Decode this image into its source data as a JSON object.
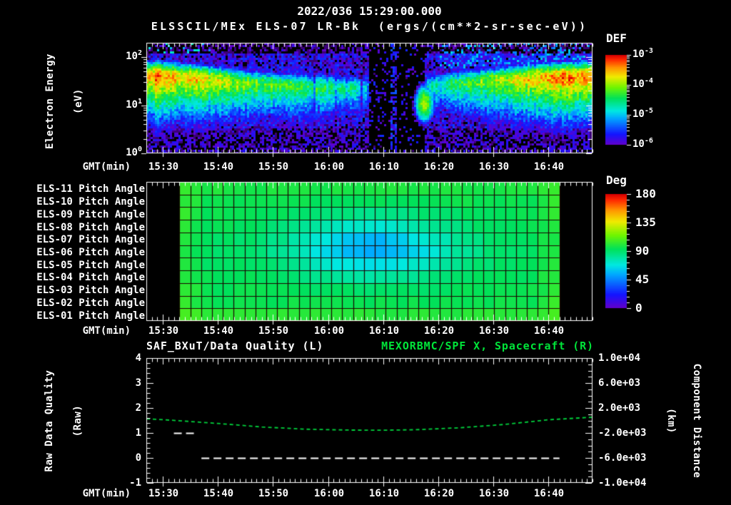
{
  "header": {
    "title": "2022/036 15:29:00.000",
    "subtitle": "ELSSCIL/MEx ELS-07 LR-Bk  (ergs/(cm**2-sr-sec-eV))"
  },
  "axis_x": {
    "label": "GMT(min)",
    "ticks": [
      "15:30",
      "15:40",
      "15:50",
      "16:00",
      "16:10",
      "16:20",
      "16:30",
      "16:40"
    ],
    "range": [
      "15:27",
      "16:48"
    ],
    "minor_step_min": 1,
    "major_step_min": 10
  },
  "colors": {
    "background": "#000000",
    "text": "#ffffff",
    "accent_green": "#00e439",
    "curve_green": "#00d23c",
    "grid_dark": "#1c0600"
  },
  "chart_data": [
    {
      "type": "heatmap",
      "name": "energy-spectrogram",
      "ylabel": {
        "line1": "Electron Energy",
        "line2": "(eV)"
      },
      "y_scale": "log",
      "y_ticks": [
        {
          "exp": "2"
        },
        {
          "exp": "1"
        },
        {
          "exp": "0"
        }
      ],
      "y_range_eV": [
        1,
        186
      ],
      "colorbar": {
        "title": "DEF",
        "units": "ergs/(cm**2-sr-sec-eV)",
        "ticks": [
          {
            "exp": "-3"
          },
          {
            "exp": "-4"
          },
          {
            "exp": "-5"
          },
          {
            "exp": "-6"
          }
        ],
        "range_log10": [
          -6,
          -3
        ]
      },
      "features": {
        "band_keypoints": [
          {
            "t": 0,
            "amp": -3.5,
            "center_logE": 1.6
          },
          {
            "t": 6,
            "amp": -3.6,
            "center_logE": 1.57
          },
          {
            "t": 13,
            "amp": -3.85,
            "center_logE": 1.5
          },
          {
            "t": 20,
            "amp": -4.15,
            "center_logE": 1.43
          },
          {
            "t": 28,
            "amp": -4.35,
            "center_logE": 1.38
          },
          {
            "t": 36,
            "amp": -4.5,
            "center_logE": 1.36
          },
          {
            "t": 40,
            "amp": -5.0,
            "center_logE": 1.35
          },
          {
            "t": 41,
            "amp": -6.6,
            "center_logE": 1.32
          },
          {
            "t": 49.5,
            "amp": -6.6,
            "center_logE": 1.35
          },
          {
            "t": 51,
            "amp": -4.8,
            "center_logE": 1.4
          },
          {
            "t": 57,
            "amp": -4.4,
            "center_logE": 1.45
          },
          {
            "t": 63,
            "amp": -4.0,
            "center_logE": 1.5
          },
          {
            "t": 70,
            "amp": -3.6,
            "center_logE": 1.55
          },
          {
            "t": 76,
            "amp": -3.3,
            "center_logE": 1.57
          },
          {
            "t": 81,
            "amp": -3.4,
            "center_logE": 1.6
          }
        ],
        "data_gap_min": [
          41,
          50
        ],
        "noise_stripe_min": [
          44.2,
          45.4
        ],
        "low_energy_blob": {
          "t_min": 50.3,
          "center_logE": 1.05,
          "peak_log10": -3.95
        }
      }
    },
    {
      "type": "heatmap",
      "name": "pitch-angle-panels",
      "rows": [
        "ELS-11 Pitch Angle",
        "ELS-10 Pitch Angle",
        "ELS-09 Pitch Angle",
        "ELS-08 Pitch Angle",
        "ELS-07 Pitch Angle",
        "ELS-06 Pitch Angle",
        "ELS-05 Pitch Angle",
        "ELS-04 Pitch Angle",
        "ELS-03 Pitch Angle",
        "ELS-02 Pitch Angle",
        "ELS-01 Pitch Angle"
      ],
      "colorbar": {
        "title": "Deg",
        "ticks": [
          180,
          135,
          90,
          45,
          0
        ],
        "range": [
          0,
          180
        ]
      },
      "data_window": [
        "15:33",
        "16:42"
      ],
      "columns": 35,
      "pattern": {
        "base_angle_deg": 92,
        "dip_min_angle_deg": 58,
        "dip_center_min": 41,
        "dip_center_row_index": 4.7,
        "dip_sigma_min": 14,
        "dip_sigma_rows": 2.3,
        "edge_boost_deg": 9
      }
    },
    {
      "type": "line",
      "name": "quality-and-distance",
      "title_left": "SAF_BXuT/Data Quality (L)",
      "title_right": "MEXORBMC/SPF X, Spacecraft (R)",
      "ylabel_left": {
        "line1": "Raw Data Quality",
        "line2": "(Raw)"
      },
      "yticks_left": [
        4,
        3,
        2,
        1,
        0,
        -1
      ],
      "ylim_left": [
        -1,
        4
      ],
      "ylabel_right": {
        "line1": "Component Distance",
        "line2": "(km)"
      },
      "yticks_right": [
        {
          "label": "1.0e+04",
          "value": 10000
        },
        {
          "label": "6.0e+03",
          "value": 6000
        },
        {
          "label": "2.0e+03",
          "value": 2000
        },
        {
          "label": "-2.0e+03",
          "value": -2000
        },
        {
          "label": "-6.0e+03",
          "value": -6000
        },
        {
          "label": "-1.0e+04",
          "value": -10000
        }
      ],
      "ylim_right": [
        -10000,
        10000
      ],
      "series": [
        {
          "name": "MEXORBMC/SPF X, Spacecraft",
          "axis": "right",
          "style": "dashed",
          "color": "#00d23c",
          "x": [
            "15:27",
            "15:33",
            "15:40",
            "15:48",
            "15:56",
            "16:04",
            "16:10",
            "16:16",
            "16:24",
            "16:32",
            "16:40",
            "16:48"
          ],
          "values_km": [
            280,
            -40,
            -480,
            -1040,
            -1400,
            -1540,
            -1560,
            -1480,
            -1160,
            -640,
            120,
            520
          ]
        },
        {
          "name": "SAF_BXuT/Data Quality",
          "axis": "left",
          "style": "dashed",
          "color": "#ffffff",
          "segments": [
            {
              "from": "15:32",
              "to": "15:36",
              "value": 1
            },
            {
              "from": "15:37",
              "to": "16:42",
              "value": 0
            }
          ]
        }
      ]
    }
  ]
}
